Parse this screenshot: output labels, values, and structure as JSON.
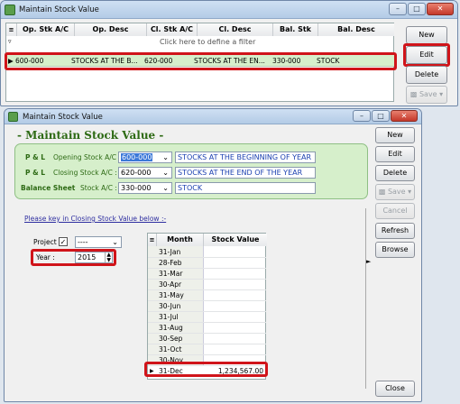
{
  "top_window": {
    "title": "Maintain Stock Value",
    "columns": [
      "Op. Stk A/C",
      "Op. Desc",
      "Cl. Stk A/C",
      "Cl. Desc",
      "Bal. Stk",
      "Bal. Desc"
    ],
    "filter_hint": "Click here to define a filter",
    "row": {
      "op_acc": "600-000",
      "op_desc": "STOCKS AT THE B...",
      "cl_acc": "620-000",
      "cl_desc": "STOCKS AT THE EN...",
      "bal_acc": "330-000",
      "bal_desc": "STOCK"
    },
    "buttons": {
      "new": "New",
      "edit": "Edit",
      "delete": "Delete",
      "save": "Save"
    }
  },
  "main_window": {
    "title": "Maintain Stock Value",
    "heading": "- Maintain Stock Value -",
    "rows": [
      {
        "group": "P & L",
        "label": "Opening Stock A/C :",
        "account": "600-000",
        "desc": "STOCKS AT THE BEGINNING OF YEAR"
      },
      {
        "group": "P & L",
        "label": "Closing Stock A/C :",
        "account": "620-000",
        "desc": "STOCKS AT THE END OF THE YEAR"
      },
      {
        "group": "Balance Sheet",
        "label": "Stock A/C :",
        "account": "330-000",
        "desc": "STOCK"
      }
    ],
    "instruction": "Please key in Closing Stock Value below :-",
    "project_label": "Project",
    "project_value": "----",
    "year_label": "Year :",
    "year_value": "2015",
    "table_headers": {
      "month": "Month",
      "value": "Stock Value"
    },
    "months": [
      "31-Jan",
      "28-Feb",
      "31-Mar",
      "30-Apr",
      "31-May",
      "30-Jun",
      "31-Jul",
      "31-Aug",
      "30-Sep",
      "31-Oct",
      "30-Nov"
    ],
    "last_row": {
      "month": "31-Dec",
      "value": "1,234,567.00"
    },
    "buttons": {
      "new": "New",
      "edit": "Edit",
      "delete": "Delete",
      "save": "Save",
      "cancel": "Cancel",
      "refresh": "Refresh",
      "browse": "Browse",
      "close": "Close"
    },
    "colors": {
      "heading": "#2d6a14",
      "green_panel": "#d6efcb",
      "red": "#d0141a"
    }
  }
}
